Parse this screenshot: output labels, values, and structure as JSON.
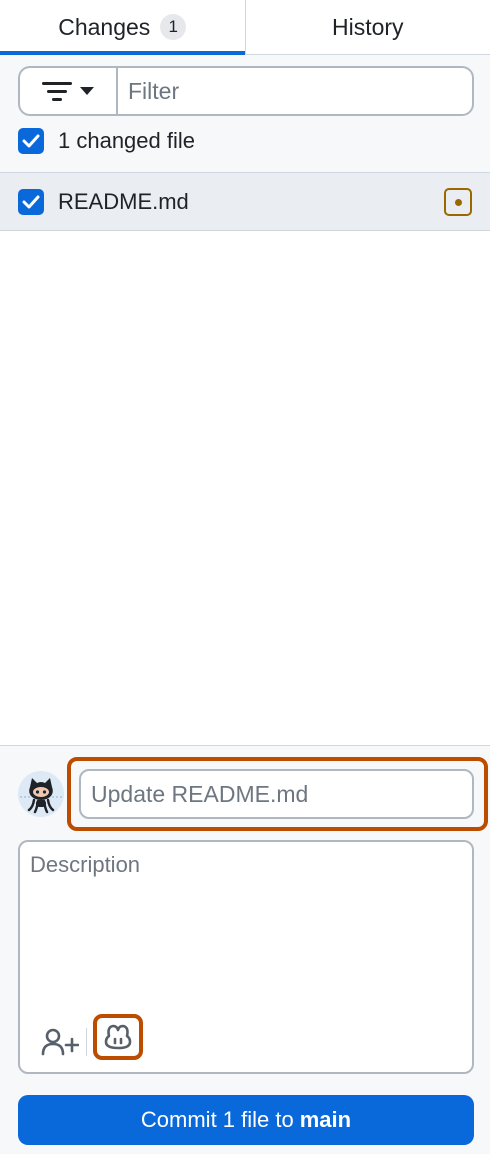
{
  "tabs": {
    "changes_label": "Changes",
    "changes_count": "1",
    "history_label": "History"
  },
  "filter": {
    "placeholder": "Filter",
    "changed_files_label": "1 changed file"
  },
  "files": [
    {
      "name": "README.md",
      "checked": true,
      "status": "modified",
      "status_icon": "file-modified-icon"
    }
  ],
  "commit": {
    "summary_placeholder": "Update README.md",
    "description_placeholder": "Description",
    "button_prefix": "Commit 1 file to",
    "branch": "main"
  },
  "colors": {
    "accent": "#0969da",
    "highlight": "#bc4c00",
    "modified": "#9a6700"
  }
}
